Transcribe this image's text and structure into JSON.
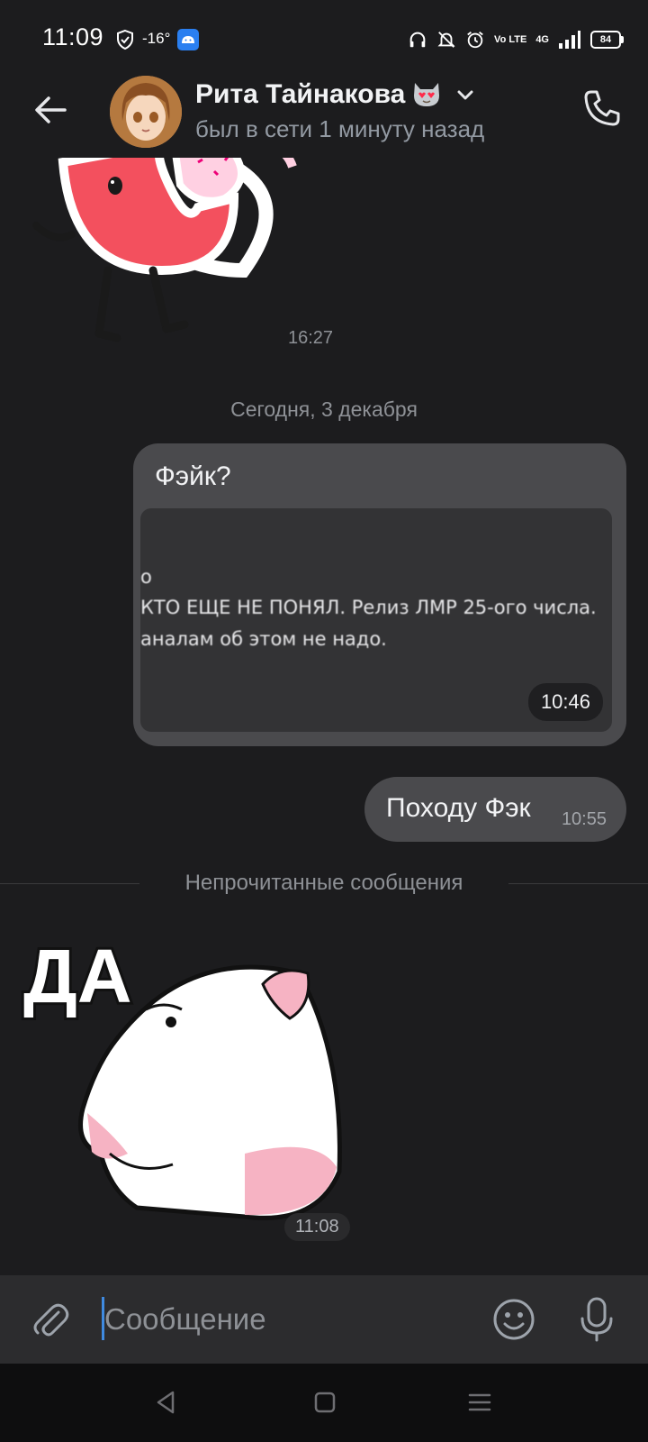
{
  "status_bar": {
    "time": "11:09",
    "temperature": "-16°",
    "volte": "Vo LTE",
    "network": "4G",
    "battery": "84"
  },
  "header": {
    "contact_name": "Рита Тайнакова",
    "status": "был в сети 1 минуту назад",
    "icons": [
      "back-arrow-icon",
      "cat-heart-eyes-emoji",
      "chevron-down-icon",
      "phone-icon"
    ]
  },
  "messages": {
    "sticker_top_time": "16:27",
    "date_divider": "Сегодня, 3 декабря",
    "msg1": {
      "text": "Фэйк?",
      "photo_lines": [
        "о",
        "КТО ЕЩЕ НЕ ПОНЯЛ. Релиз ЛМР 25-ого числа.",
        "аналам об этом не надо."
      ],
      "time": "10:46"
    },
    "msg2": {
      "text": "Походу Фэк",
      "time": "10:55"
    },
    "unread_divider": "Непрочитанные сообщения",
    "sticker_bottom": {
      "text": "ДА",
      "time": "11:08"
    }
  },
  "composer": {
    "placeholder": "Сообщение",
    "icons": [
      "paperclip-icon",
      "smile-icon",
      "microphone-icon"
    ]
  },
  "colors": {
    "background": "#1c1c1e",
    "bubble": "#4a4a4d",
    "accent": "#3f8ae0"
  }
}
